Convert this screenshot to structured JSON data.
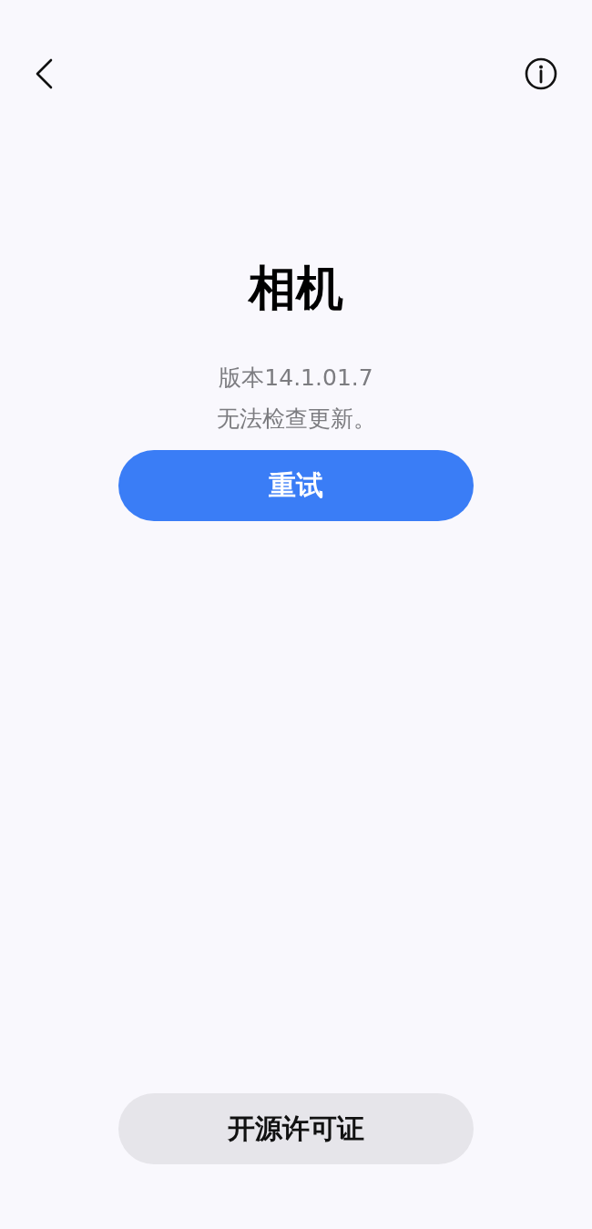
{
  "app_name": "相机",
  "version": "版本14.1.01.7",
  "status": "无法检查更新。",
  "retry_button": "重试",
  "license_button": "开源许可证"
}
